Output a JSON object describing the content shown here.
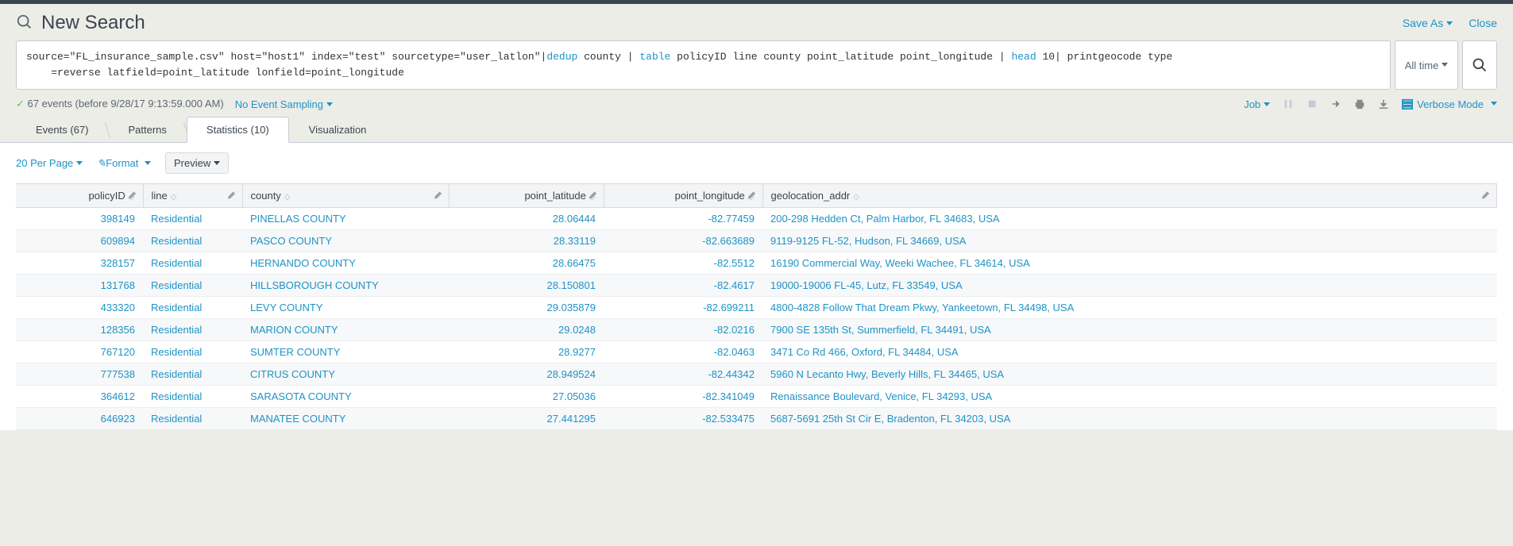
{
  "header": {
    "title": "New Search",
    "save_as": "Save As",
    "close": "Close"
  },
  "search": {
    "query_pre1": "source=\"FL_insurance_sample.csv\" host=\"host1\" index=\"test\" sourcetype=\"user_latlon\"|",
    "cmd_dedup": "dedup",
    "query_dedup_args": " county | ",
    "cmd_table": "table",
    "query_table_args": " policyID line county point_latitude point_longitude | ",
    "cmd_head": "head",
    "query_head_args": " 10| printgeocode type",
    "query_line2": "=reverse latfield=point_latitude lonfield=point_longitude",
    "time_label": "All time"
  },
  "status": {
    "events_text": "67 events (before 9/28/17 9:13:59.000 AM)",
    "sampling": "No Event Sampling",
    "job": "Job",
    "verbose": "Verbose Mode"
  },
  "tabs": {
    "events": "Events (67)",
    "patterns": "Patterns",
    "statistics": "Statistics (10)",
    "visualization": "Visualization"
  },
  "toolbar": {
    "per_page": "20 Per Page",
    "format": "Format",
    "preview": "Preview"
  },
  "columns": {
    "policyID": "policyID",
    "line": "line",
    "county": "county",
    "point_latitude": "point_latitude",
    "point_longitude": "point_longitude",
    "geolocation_addr": "geolocation_addr"
  },
  "rows": [
    {
      "policyID": "398149",
      "line": "Residential",
      "county": "PINELLAS COUNTY",
      "lat": "28.06444",
      "lon": "-82.77459",
      "addr": "200-298 Hedden Ct, Palm Harbor, FL 34683, USA"
    },
    {
      "policyID": "609894",
      "line": "Residential",
      "county": "PASCO COUNTY",
      "lat": "28.33119",
      "lon": "-82.663689",
      "addr": "9119-9125 FL-52, Hudson, FL 34669, USA"
    },
    {
      "policyID": "328157",
      "line": "Residential",
      "county": "HERNANDO COUNTY",
      "lat": "28.66475",
      "lon": "-82.5512",
      "addr": "16190 Commercial Way, Weeki Wachee, FL 34614, USA"
    },
    {
      "policyID": "131768",
      "line": "Residential",
      "county": "HILLSBOROUGH COUNTY",
      "lat": "28.150801",
      "lon": "-82.4617",
      "addr": "19000-19006 FL-45, Lutz, FL 33549, USA"
    },
    {
      "policyID": "433320",
      "line": "Residential",
      "county": "LEVY COUNTY",
      "lat": "29.035879",
      "lon": "-82.699211",
      "addr": "4800-4828 Follow That Dream Pkwy, Yankeetown, FL 34498, USA"
    },
    {
      "policyID": "128356",
      "line": "Residential",
      "county": "MARION COUNTY",
      "lat": "29.0248",
      "lon": "-82.0216",
      "addr": "7900 SE 135th St, Summerfield, FL 34491, USA"
    },
    {
      "policyID": "767120",
      "line": "Residential",
      "county": "SUMTER COUNTY",
      "lat": "28.9277",
      "lon": "-82.0463",
      "addr": "3471 Co Rd 466, Oxford, FL 34484, USA"
    },
    {
      "policyID": "777538",
      "line": "Residential",
      "county": "CITRUS COUNTY",
      "lat": "28.949524",
      "lon": "-82.44342",
      "addr": "5960 N Lecanto Hwy, Beverly Hills, FL 34465, USA"
    },
    {
      "policyID": "364612",
      "line": "Residential",
      "county": "SARASOTA COUNTY",
      "lat": "27.05036",
      "lon": "-82.341049",
      "addr": "Renaissance Boulevard, Venice, FL 34293, USA"
    },
    {
      "policyID": "646923",
      "line": "Residential",
      "county": "MANATEE COUNTY",
      "lat": "27.441295",
      "lon": "-82.533475",
      "addr": "5687-5691 25th St Cir E, Bradenton, FL 34203, USA"
    }
  ]
}
